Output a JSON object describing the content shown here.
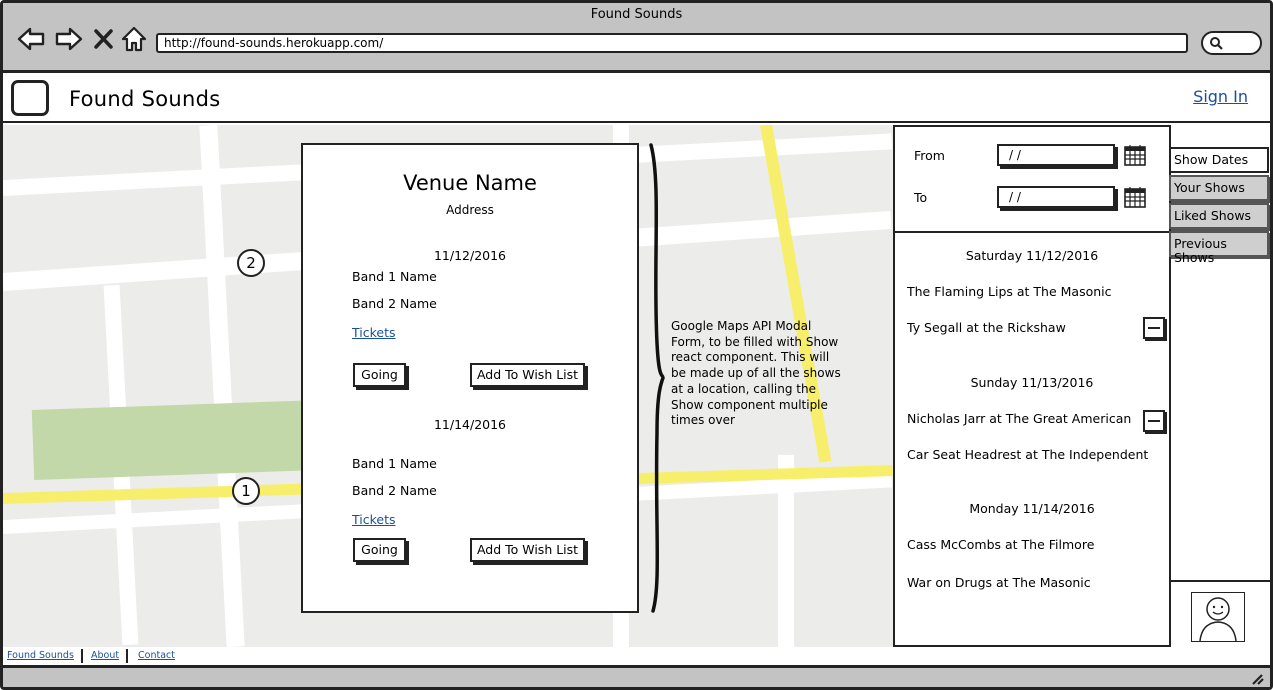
{
  "browser": {
    "title": "Found Sounds",
    "url": "http://found-sounds.herokuapp.com/"
  },
  "header": {
    "app_title": "Found Sounds",
    "sign_in": "Sign In"
  },
  "map": {
    "markers": [
      "2",
      "1"
    ]
  },
  "venue": {
    "name": "Venue Name",
    "address": "Address",
    "shows": [
      {
        "date": "11/12/2016",
        "bands": [
          "Band 1 Name",
          "Band 2 Name"
        ],
        "tickets": "Tickets",
        "going": "Going",
        "wish": "Add To Wish List"
      },
      {
        "date": "11/14/2016",
        "bands": [
          "Band 1 Name",
          "Band 2 Name"
        ],
        "tickets": "Tickets",
        "going": "Going",
        "wish": "Add To Wish List"
      }
    ]
  },
  "annotation": "Google Maps API Modal Form, to be filled with Show react component. This will be made up of all the shows at a location, calling the Show component multiple times over",
  "filters": {
    "from_label": "From",
    "to_label": "To",
    "from_value": "/ /",
    "to_value": "/ /"
  },
  "schedule": {
    "days": [
      {
        "heading": "Saturday 11/12/2016",
        "shows": [
          "The Flaming Lips at The Masonic",
          "Ty Segall at the Rickshaw"
        ]
      },
      {
        "heading": "Sunday 11/13/2016",
        "shows": [
          "Nicholas Jarr at The Great American",
          "Car Seat Headrest at The Independent"
        ]
      },
      {
        "heading": "Monday 11/14/2016",
        "shows": [
          "Cass McCombs at The Filmore",
          "War on Drugs at The Masonic"
        ]
      }
    ]
  },
  "tabs": [
    "Show Dates",
    "Your Shows",
    "Liked Shows",
    "Previous Shows"
  ],
  "footer": {
    "links": [
      "Found Sounds",
      "About",
      "Contact"
    ]
  },
  "colors": {
    "link": "#1a4f9c",
    "map_road_highlight": "#f7ef6c",
    "map_park": "#c3d8a8",
    "chrome": "#c3c3c3"
  }
}
